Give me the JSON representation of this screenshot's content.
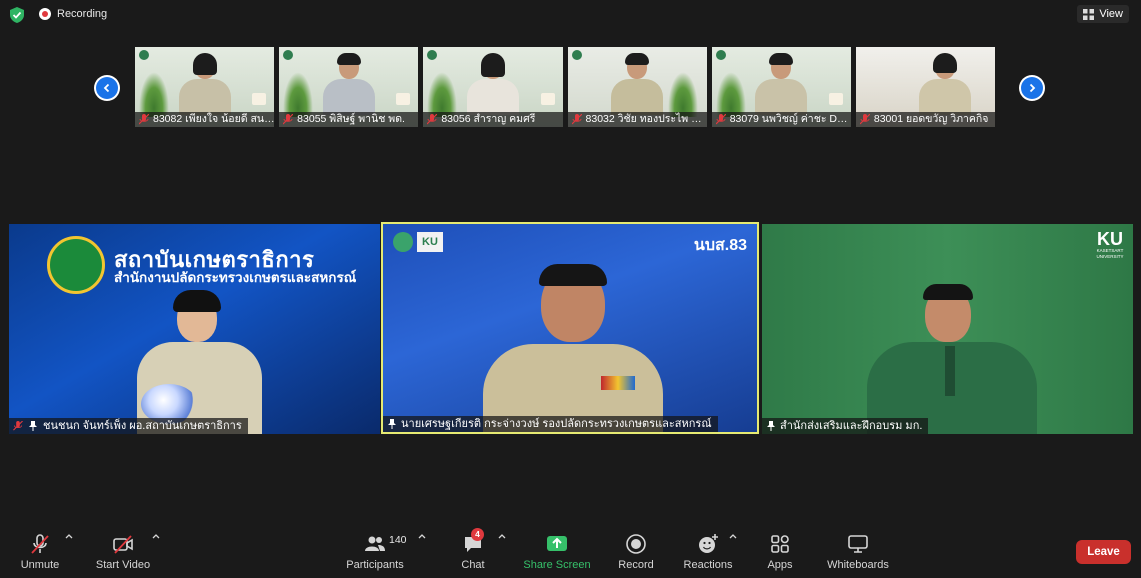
{
  "top_bar": {
    "recording_label": "Recording",
    "view_label": "View"
  },
  "strip": {
    "thumbnails": [
      {
        "caption": "83082 เพียงใจ น้อยดี สนง..."
      },
      {
        "caption": "83055 พิสิษฐ์ พานิช พด."
      },
      {
        "caption": "83056 สำราญ คมศรี"
      },
      {
        "caption": "83032 วิชัย ทองประไพ กร..."
      },
      {
        "caption": "83079 นพวิชญ์ ค่าชะ DO..."
      },
      {
        "caption": "83001 ยอดขวัญ วิภาคกิจ"
      }
    ]
  },
  "main_tiles": [
    {
      "caption": "ชนชนก จันทร์เพ็ง ผอ.สถาบันเกษตราธิการ",
      "banner_title": "สถาบันเกษตราธิการ",
      "banner_subtitle": "สำนักงานปลัดกระทรวงเกษตรและสหกรณ์"
    },
    {
      "caption": "นายเศรษฐเกียรติ กระจ่างวงษ์ รองปลัดกระทรวงเกษตรและสหกรณ์",
      "logo_text": "KU",
      "brand_text": "นบส.83"
    },
    {
      "caption": "สำนักส่งเสริมและฝึกอบรม มก.",
      "logo_text": "KU",
      "logo_sub": "KASETSART UNIVERSITY"
    }
  ],
  "toolbar": {
    "unmute": "Unmute",
    "start_video": "Start Video",
    "participants": "Participants",
    "participants_count": "140",
    "chat": "Chat",
    "chat_badge": "4",
    "share_screen": "Share Screen",
    "record": "Record",
    "reactions": "Reactions",
    "apps": "Apps",
    "whiteboards": "Whiteboards",
    "leave": "Leave"
  },
  "colors": {
    "share_green": "#36c06a",
    "leave_red": "#c9302c",
    "active_speaker_border": "#e6ea72",
    "nav_blue": "#1a73e8"
  }
}
